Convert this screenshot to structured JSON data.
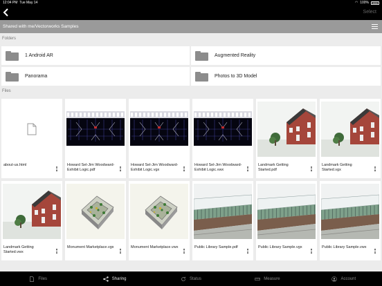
{
  "status_bar": {
    "time": "12:04 PM",
    "date": "Tue May 14",
    "battery": "100%"
  },
  "nav": {
    "select_label": "Select",
    "back_icon": "chevron-left-icon"
  },
  "path": "Shared with me/Vectorworks Samples",
  "sections": {
    "folders": "Folders",
    "files": "Files"
  },
  "folders": [
    {
      "name": "1 Android AR"
    },
    {
      "name": "Augmented Reality"
    },
    {
      "name": "Panorama"
    },
    {
      "name": "Photos to 3D Model"
    }
  ],
  "files": [
    {
      "name": "about-us.html",
      "thumb": "document-icon"
    },
    {
      "name": "Howard Sel-Jim Woodward-Exhibit Logic.pdf",
      "thumb": "drawing"
    },
    {
      "name": "Howard Sel-Jim Woodward-Exhibit Logic.vgx",
      "thumb": "drawing"
    },
    {
      "name": "Howard Sel-Jim Woodward-Exhibit Logic.vwx",
      "thumb": "drawing"
    },
    {
      "name": "Landmark Getting Started.pdf",
      "thumb": "house"
    },
    {
      "name": "Landmark Getting Started.vgx",
      "thumb": "house"
    },
    {
      "name": "Landmark Getting Started.vwx",
      "thumb": "house"
    },
    {
      "name": "Monument Marketplace.vgx",
      "thumb": "monument"
    },
    {
      "name": "Monument Marketplace.vwx",
      "thumb": "monument"
    },
    {
      "name": "Public Library Sample.pdf",
      "thumb": "library"
    },
    {
      "name": "Public Library Sample.vgx",
      "thumb": "library"
    },
    {
      "name": "Public Library Sample.vwx",
      "thumb": "library"
    }
  ],
  "tabs": [
    {
      "label": "Files",
      "icon": "file-icon",
      "active": false
    },
    {
      "label": "Sharing",
      "icon": "share-icon",
      "active": true
    },
    {
      "label": "Status",
      "icon": "refresh-icon",
      "active": false
    },
    {
      "label": "Measure",
      "icon": "ruler-icon",
      "active": false
    },
    {
      "label": "Account",
      "icon": "person-icon",
      "active": false
    }
  ],
  "colors": {
    "bar_bg": "#000000",
    "path_bg": "#9a9a9a",
    "page_bg": "#ececec",
    "folder_icon": "#8c8c8c"
  }
}
